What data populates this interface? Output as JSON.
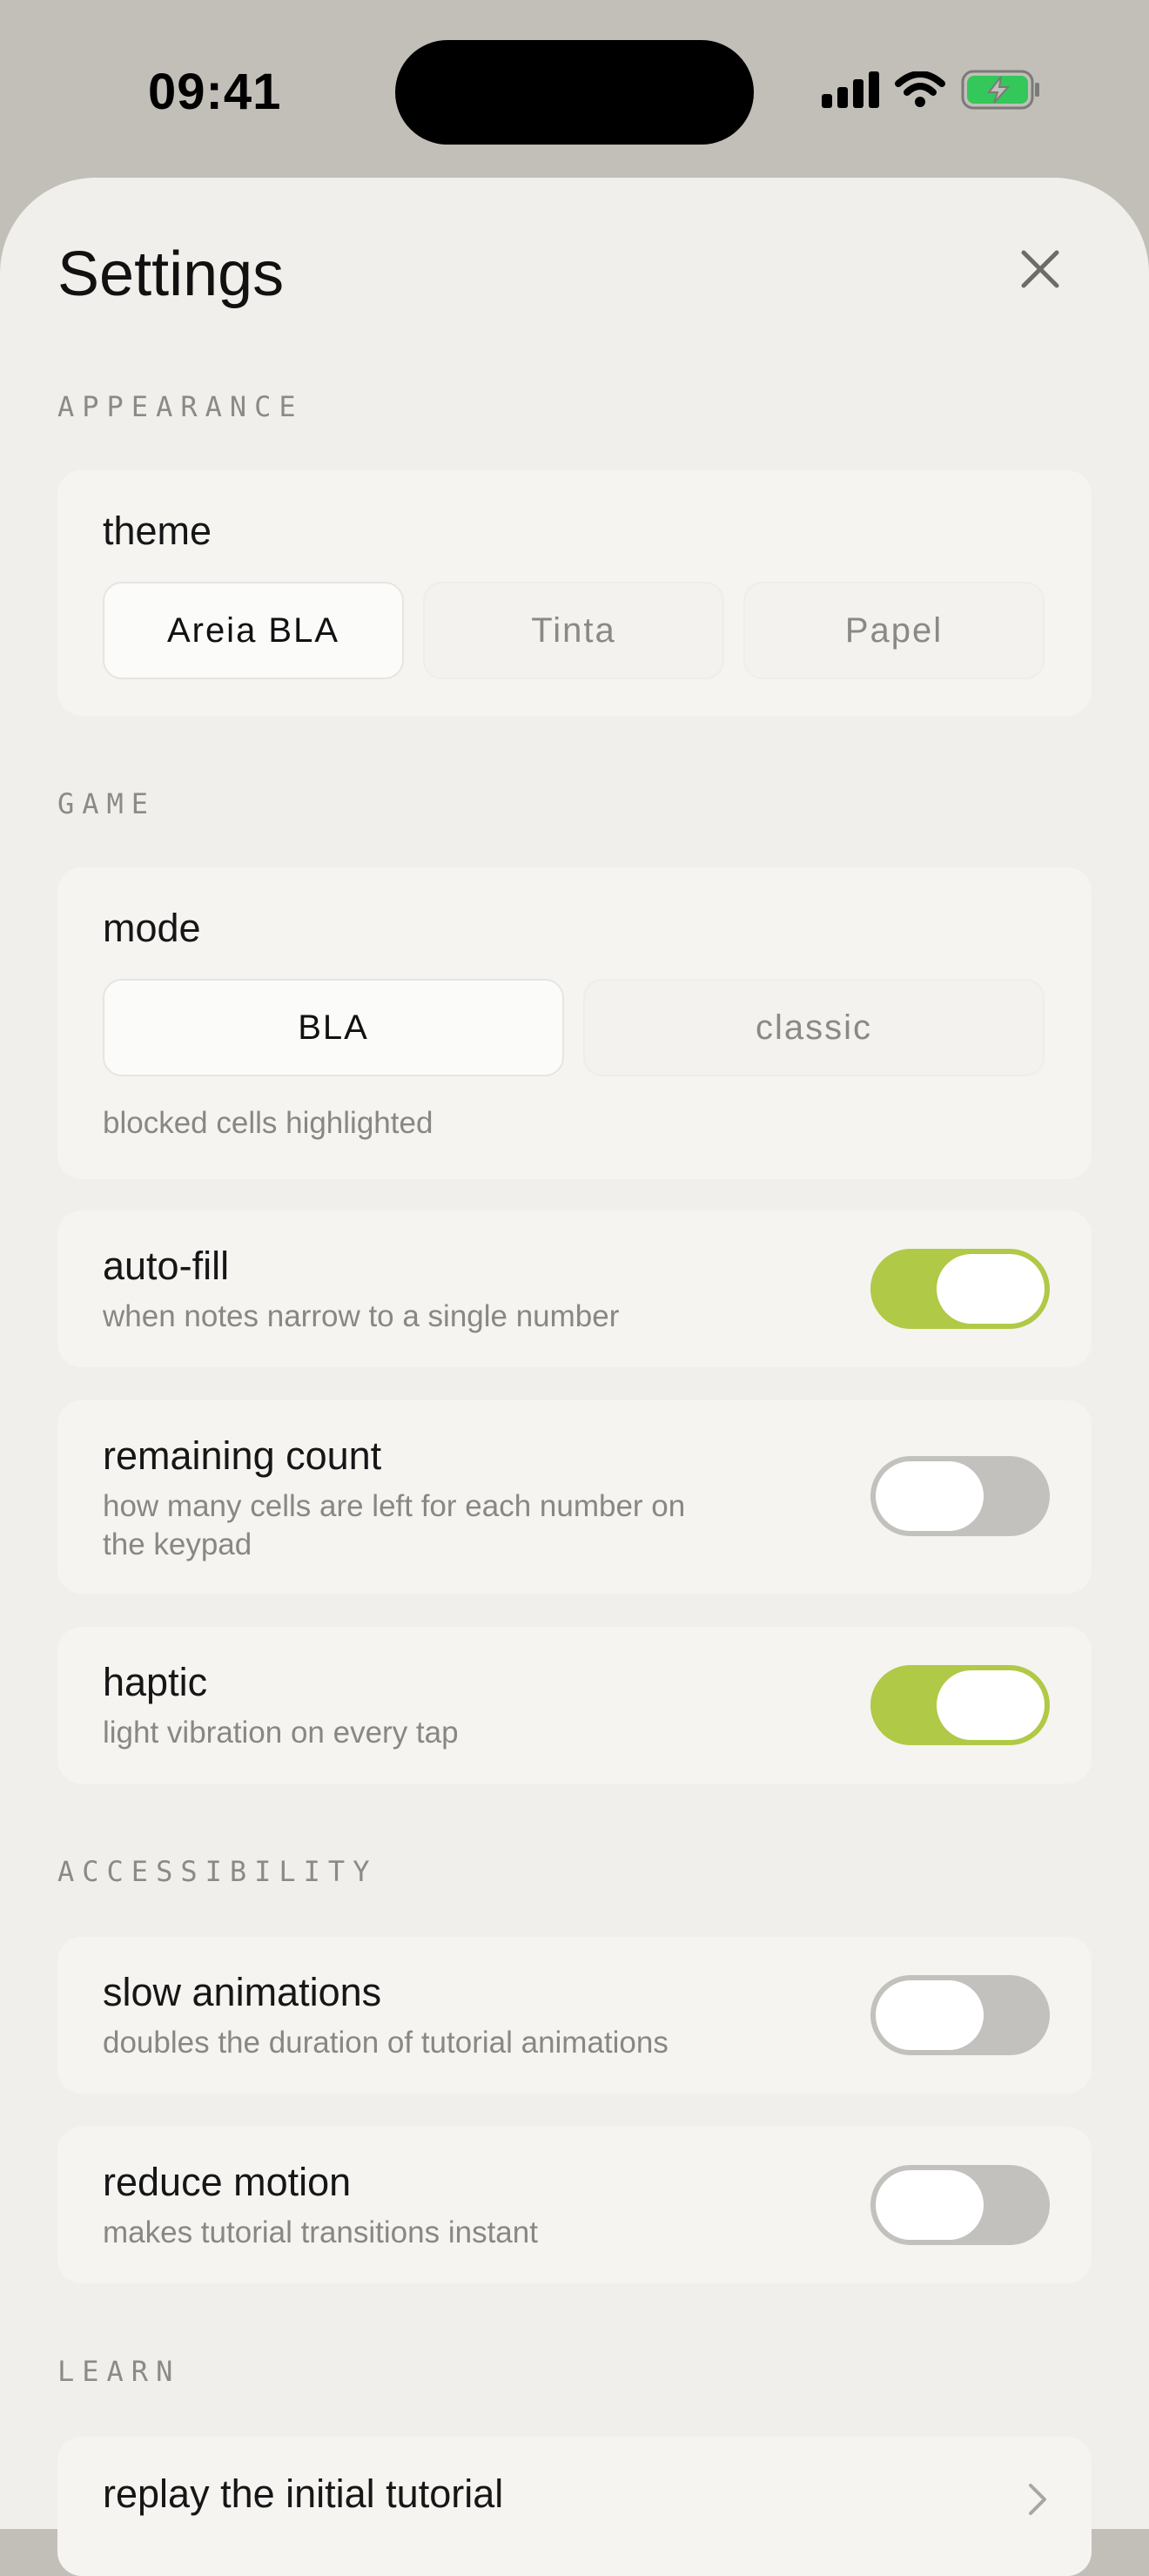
{
  "status": {
    "time": "09:41"
  },
  "sheet": {
    "title": "Settings"
  },
  "sections": {
    "appearance": "APPEARANCE",
    "game": "GAME",
    "accessibility": "ACCESSIBILITY",
    "learn": "LEARN"
  },
  "theme": {
    "title": "theme",
    "options": [
      "Areia BLA",
      "Tinta",
      "Papel"
    ],
    "selected": "Areia BLA"
  },
  "mode": {
    "title": "mode",
    "options": [
      "BLA",
      "classic"
    ],
    "selected": "BLA",
    "description": "blocked cells highlighted"
  },
  "toggles": {
    "autofill": {
      "title": "auto-fill",
      "description": "when notes narrow to a single number",
      "enabled": true
    },
    "remaining": {
      "title": "remaining count",
      "description_line1": "how many cells are left for each number on",
      "description_line2": "the keypad",
      "enabled": false
    },
    "haptic": {
      "title": "haptic",
      "description": "light vibration on every tap",
      "enabled": true
    },
    "slow_animations": {
      "title": "slow animations",
      "description": "doubles the duration of tutorial animations",
      "enabled": false
    },
    "reduce_motion": {
      "title": "reduce motion",
      "description": "makes tutorial transitions instant",
      "enabled": false
    }
  },
  "learn": {
    "replay_tutorial": "replay the initial tutorial"
  },
  "colors": {
    "accent": "#b0c946",
    "sheet": "#f1efeb",
    "card": "#f5f4f1",
    "toggle_off": "#c2c1be"
  }
}
